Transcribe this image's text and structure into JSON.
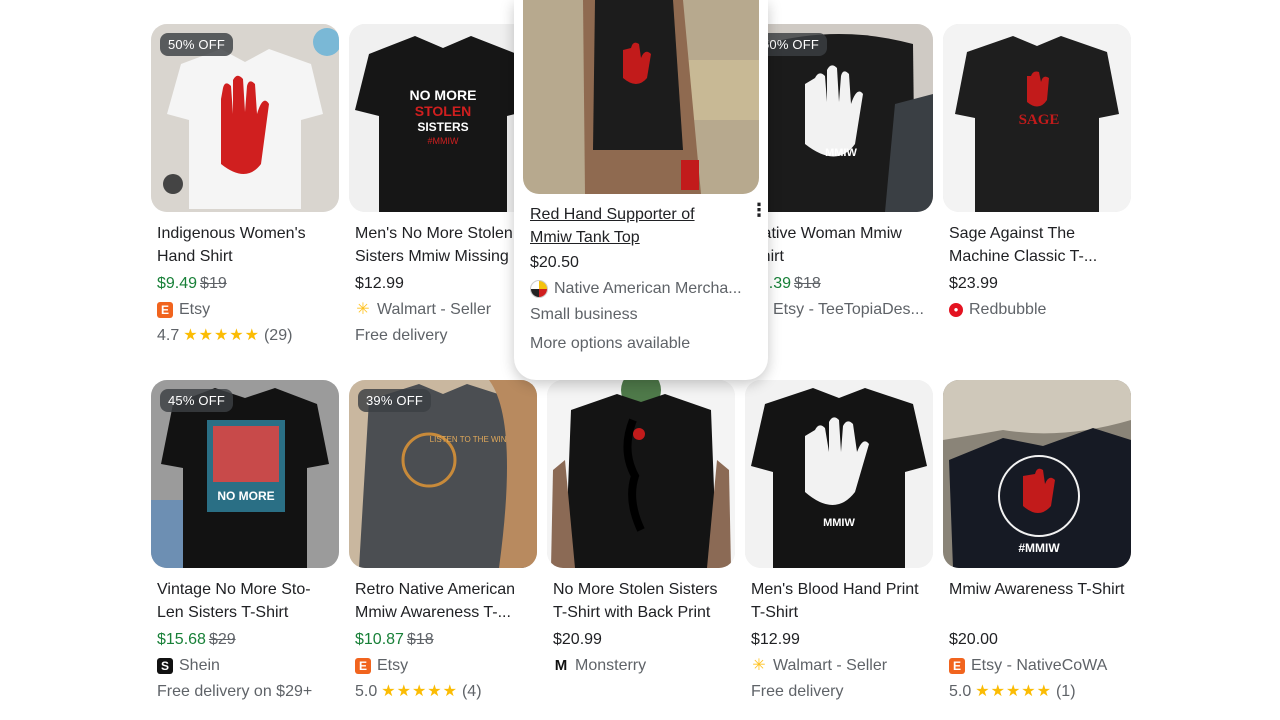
{
  "row1": [
    {
      "title": "Indigenous Women's Hand Shirt",
      "badge": "50% OFF",
      "price": "$9.49",
      "was": "$19",
      "seller": "Etsy",
      "seller_icon": "etsy-icon",
      "extra_rating": "4.7",
      "extra_count": "(29)",
      "img_color": "#eeeeee",
      "has_rating": true
    },
    {
      "title": "Men's No More Stolen Sisters Mmiw Missing",
      "price": "$12.99",
      "seller": "Walmart - Seller",
      "seller_icon": "walmart-spark-icon",
      "extra": "Free delivery",
      "img_color": "#efefef"
    },
    {
      "title": "Native Woman Mmiw Shirt",
      "badge": "50% OFF",
      "price": "$9.39",
      "was": "$18",
      "seller": "Etsy - TeeTopiaDes...",
      "seller_icon": "etsy-icon",
      "img_color": "#dcdcdc"
    },
    {
      "title": "Sage Against The Machine Classic T-...",
      "price": "$23.99",
      "seller": "Redbubble",
      "seller_icon": "redbubble-icon",
      "img_color": "#f1f1f1"
    }
  ],
  "popup": {
    "title": "Red Hand Supporter of Mmiw Tank Top",
    "price": "$20.50",
    "seller": "Native American Mercha...",
    "seller_icon": "native-american-icon",
    "small_business": "Small business",
    "more_options": "More options available",
    "menu": "⋮"
  },
  "row2": [
    {
      "title": "Vintage No More Sto- Len Sisters T-Shirt",
      "badge": "45% OFF",
      "price": "$15.68",
      "was": "$29",
      "seller": "Shein",
      "seller_icon": "shein-icon",
      "extra": "Free delivery on $29+"
    },
    {
      "title": "Retro Native American Mmiw Awareness T-...",
      "badge": "39% OFF",
      "price": "$10.87",
      "was": "$18",
      "seller": "Etsy",
      "seller_icon": "etsy-icon",
      "extra_rating": "5.0",
      "extra_count": "(4)",
      "has_rating": true
    },
    {
      "title": "No More Stolen Sisters T-Shirt with Back Print",
      "price": "$20.99",
      "seller": "Monsterry",
      "seller_icon": "monsterry-icon"
    },
    {
      "title": "Men's Blood Hand Print T-Shirt",
      "price": "$12.99",
      "seller": "Walmart - Seller",
      "seller_icon": "walmart-spark-icon",
      "extra": "Free delivery"
    },
    {
      "title": "Mmiw Awareness T-Shirt",
      "price": "$20.00",
      "seller": "Etsy - NativeCoWA",
      "seller_icon": "etsy-icon",
      "extra_rating": "5.0",
      "extra_count": "(1)",
      "has_rating": true
    }
  ],
  "image_text": {
    "stolen_sisters": "NO MORE STOLEN SISTERS",
    "hashtag": "#MMIW",
    "mmiw": "MMIW",
    "sage": "SAGE",
    "vintage": "NO MORE",
    "vintage_sub": "STOLEN SISTERS",
    "listen": "LISTEN TO THE WIND"
  },
  "colors": {
    "sale_green": "#188038",
    "star": "#fbbc04",
    "etsy": "#f1641e",
    "walmart": "#ffc220",
    "redbubble": "#e41321"
  }
}
